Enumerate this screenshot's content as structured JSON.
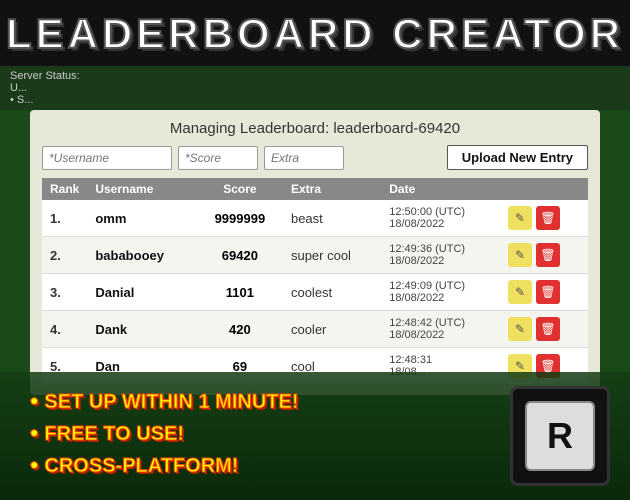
{
  "title": "LEADERBOARD CREATOR",
  "server_status": {
    "label": "Server Status:",
    "lines": [
      "U...",
      "• S..."
    ]
  },
  "managing": {
    "prefix": "Managing Leaderboard:",
    "id": "leaderboard-69420"
  },
  "inputs": {
    "username_placeholder": "*Username",
    "score_placeholder": "*Score",
    "extra_placeholder": "Extra",
    "upload_button": "Upload New Entry"
  },
  "table": {
    "headers": [
      "Rank",
      "Username",
      "Score",
      "Extra",
      "Date",
      ""
    ],
    "rows": [
      {
        "rank": "1.",
        "username": "omm",
        "score": "9999999",
        "extra": "beast",
        "date": "12:50:00 (UTC)\n18/08/2022"
      },
      {
        "rank": "2.",
        "username": "bababooey",
        "score": "69420",
        "extra": "super cool",
        "date": "12:49:36 (UTC)\n18/08/2022"
      },
      {
        "rank": "3.",
        "username": "Danial",
        "score": "1101",
        "extra": "coolest",
        "date": "12:49:09 (UTC)\n18/08/2022"
      },
      {
        "rank": "4.",
        "username": "Dank",
        "score": "420",
        "extra": "cooler",
        "date": "12:48:42 (UTC)\n18/08/2022"
      },
      {
        "rank": "5.",
        "username": "Dan",
        "score": "69",
        "extra": "cool",
        "date": "12:48:31\n18/08..."
      }
    ]
  },
  "bullets": [
    "SET UP WITHIN 1 MINUTE!",
    "FREE TO USE!",
    "CROSS-PLATFORM!"
  ],
  "logo_text": "R"
}
